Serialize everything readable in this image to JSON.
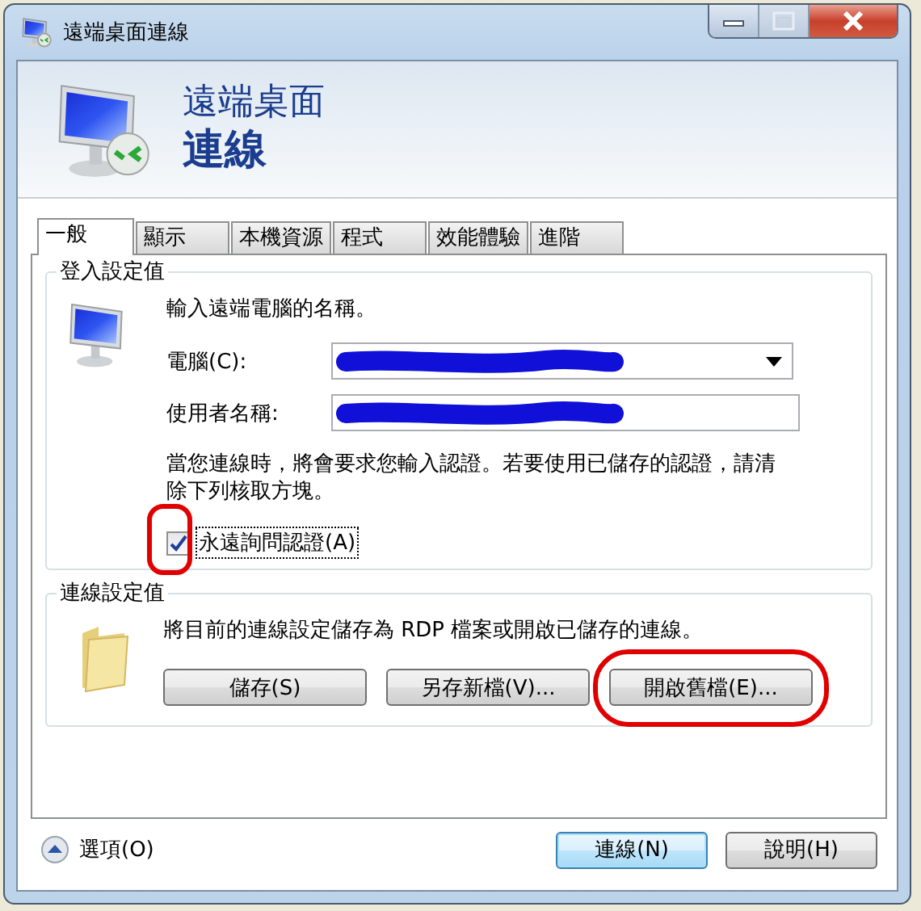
{
  "window": {
    "title": "遠端桌面連線"
  },
  "header": {
    "line_1": "遠端桌面",
    "line_2": "連線"
  },
  "tabs": [
    {
      "label": "一般",
      "selected": true
    },
    {
      "label": "顯示",
      "selected": false
    },
    {
      "label": "本機資源",
      "selected": false
    },
    {
      "label": "程式",
      "selected": false
    },
    {
      "label": "效能體驗",
      "selected": false
    },
    {
      "label": "進階",
      "selected": false
    }
  ],
  "logon": {
    "title": "登入設定值",
    "prompt": "輸入遠端電腦的名稱。",
    "computer": {
      "label": "電腦(C):",
      "redacted": true
    },
    "user": {
      "label": "使用者名稱:",
      "redacted": true
    },
    "note": "當您連線時，將會要求您輸入認證。若要使用已儲存的認證，請清除下列核取方塊。",
    "checkbox": {
      "label": "永遠詢問認證(A)",
      "checked": true,
      "focused": true,
      "highlighted": true
    }
  },
  "connection": {
    "title": "連線設定值",
    "description": "將目前的連線設定儲存為 RDP 檔案或開啟已儲存的連線。",
    "buttons": [
      {
        "label": "儲存(S)",
        "highlighted": false
      },
      {
        "label": "另存新檔(V)...",
        "highlighted": false
      },
      {
        "label": "開啟舊檔(E)...",
        "highlighted": true
      }
    ]
  },
  "footer": {
    "options": "選項(O)",
    "buttons": [
      {
        "label": "連線(N)",
        "default": true
      },
      {
        "label": "說明(H)",
        "default": false
      }
    ]
  }
}
